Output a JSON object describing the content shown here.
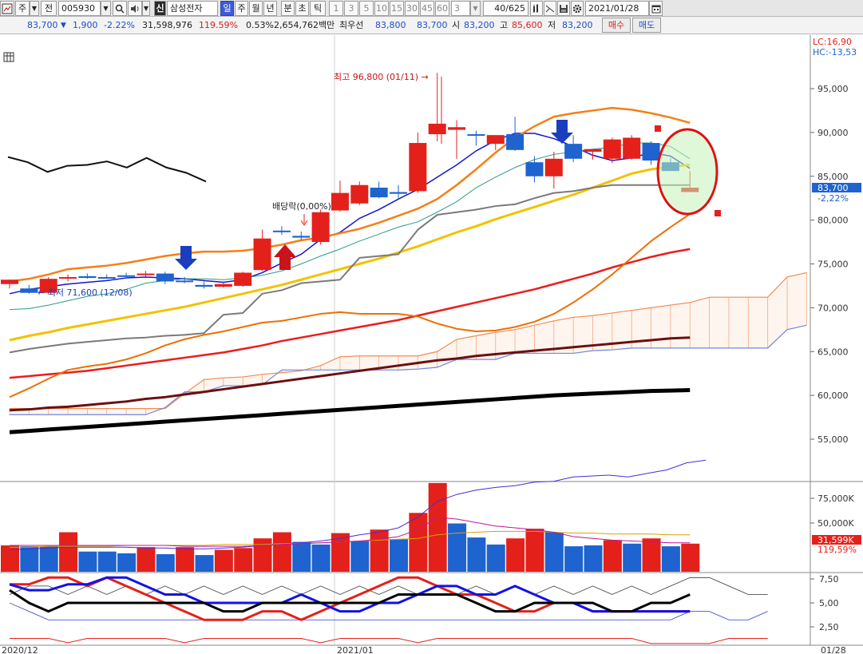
{
  "toolbar": {
    "market": "주",
    "jeon": "전",
    "code": "005930",
    "credit_badge": "신",
    "stock_name": "삼성전자",
    "periods": [
      "일",
      "주",
      "월",
      "년",
      "분",
      "초",
      "틱"
    ],
    "active_period": "일",
    "intervals": [
      "1",
      "3",
      "5",
      "10",
      "15",
      "30",
      "45",
      "60"
    ],
    "interval_value": "3",
    "page_count": "40/625",
    "date": "2021/01/28"
  },
  "quote": {
    "price": "83,700",
    "change": "1,900",
    "change_pct": "-2.22%",
    "volume": "31,598,976",
    "vol_ratio": "119.59%",
    "turnover": "0.53%",
    "amount": "2,654,762백만",
    "bid_label": "최우선",
    "bid_sell": "83,800",
    "bid_buy": "83,700",
    "open_label": "시",
    "open": "83,200",
    "high_label": "고",
    "high": "85,600",
    "low_label": "저",
    "low": "83,200",
    "buy_button": "매수",
    "sell_button": "매도"
  },
  "colors": {
    "up": "#e4201b",
    "down": "#1e63cf",
    "bg": "#ffffff",
    "axis": "#333333"
  },
  "icons": [
    "dropdown-arrow-icon",
    "search-icon",
    "speaker-icon",
    "grid-icon",
    "chart-settings-icon",
    "save-icon",
    "gear-icon",
    "calendar-icon",
    "chart-menu-icon",
    "arrow-down-icon",
    "arrow-up-icon"
  ],
  "chart_data": {
    "type": "candlestick",
    "price_axis": {
      "min": 55000,
      "max": 95000,
      "ticks": [
        "95,000",
        "90,000",
        "85,000",
        "80,000",
        "75,000",
        "70,000",
        "65,000",
        "60,000",
        "55,000"
      ]
    },
    "volume_axis": {
      "ticks": [
        "75,000K",
        "50,000K"
      ]
    },
    "osc_axis": {
      "ticks": [
        "7,50",
        "5,00",
        "2,50"
      ]
    },
    "x_labels": [
      "2020/12",
      "2021/01",
      "01/28"
    ],
    "legend": {
      "lc": "LC:16,90",
      "hc": "HC:-13,53"
    },
    "last_price_label": "83,700",
    "last_change_label": "-2,22%",
    "last_volume_label": "31,599K",
    "last_vol_ratio_label": "119,59%",
    "annotations": {
      "high": "최고 96,800 (01/11) →",
      "low": "← 최저 71,600 (12/08)",
      "dividend": "배당락(0,00%)"
    },
    "candles": [
      {
        "o": 72700,
        "h": 73200,
        "l": 72200,
        "c": 73200
      },
      {
        "o": 72200,
        "h": 72600,
        "l": 71600,
        "c": 71700
      },
      {
        "o": 71700,
        "h": 73500,
        "l": 71600,
        "c": 73300
      },
      {
        "o": 73400,
        "h": 73800,
        "l": 73000,
        "c": 73500
      },
      {
        "o": 73600,
        "h": 73900,
        "l": 73300,
        "c": 73400
      },
      {
        "o": 73500,
        "h": 73800,
        "l": 73300,
        "c": 73400
      },
      {
        "o": 73700,
        "h": 74000,
        "l": 73400,
        "c": 73600
      },
      {
        "o": 73800,
        "h": 74200,
        "l": 73500,
        "c": 73900
      },
      {
        "o": 73900,
        "h": 74100,
        "l": 72700,
        "c": 73000
      },
      {
        "o": 73100,
        "h": 73500,
        "l": 72800,
        "c": 73000
      },
      {
        "o": 72600,
        "h": 73000,
        "l": 72200,
        "c": 72400
      },
      {
        "o": 72400,
        "h": 73000,
        "l": 72300,
        "c": 72700
      },
      {
        "o": 72500,
        "h": 74100,
        "l": 72400,
        "c": 74000
      },
      {
        "o": 74300,
        "h": 78900,
        "l": 74200,
        "c": 77900
      },
      {
        "o": 78800,
        "h": 79300,
        "l": 78300,
        "c": 78700
      },
      {
        "o": 78200,
        "h": 78700,
        "l": 77700,
        "c": 78000
      },
      {
        "o": 77500,
        "h": 81200,
        "l": 77200,
        "c": 80900
      },
      {
        "o": 81100,
        "h": 84500,
        "l": 81000,
        "c": 83100
      },
      {
        "o": 81900,
        "h": 84400,
        "l": 81700,
        "c": 84000
      },
      {
        "o": 83700,
        "h": 84400,
        "l": 82500,
        "c": 82600
      },
      {
        "o": 83200,
        "h": 84000,
        "l": 82400,
        "c": 83000
      },
      {
        "o": 83300,
        "h": 90000,
        "l": 83100,
        "c": 88800
      },
      {
        "o": 89800,
        "h": 96800,
        "l": 89000,
        "c": 91000
      },
      {
        "o": 90300,
        "h": 91400,
        "l": 87000,
        "c": 90600
      },
      {
        "o": 89800,
        "h": 90200,
        "l": 88500,
        "c": 89700
      },
      {
        "o": 88700,
        "h": 89700,
        "l": 88000,
        "c": 89700
      },
      {
        "o": 89800,
        "h": 91800,
        "l": 87900,
        "c": 88000
      },
      {
        "o": 86600,
        "h": 87300,
        "l": 84300,
        "c": 85000
      },
      {
        "o": 85000,
        "h": 87800,
        "l": 83600,
        "c": 87000
      },
      {
        "o": 88700,
        "h": 89700,
        "l": 86600,
        "c": 87000
      },
      {
        "o": 87800,
        "h": 88000,
        "l": 86900,
        "c": 88100
      },
      {
        "o": 87000,
        "h": 89400,
        "l": 86500,
        "c": 89200
      },
      {
        "o": 87000,
        "h": 89700,
        "l": 86900,
        "c": 89400
      },
      {
        "o": 88800,
        "h": 89000,
        "l": 86300,
        "c": 86800
      },
      {
        "o": 86600,
        "h": 87100,
        "l": 85800,
        "c": 85600
      },
      {
        "o": 83200,
        "h": 85600,
        "l": 83200,
        "c": 83700
      }
    ],
    "volume": [
      {
        "v": 30,
        "up": true
      },
      {
        "v": 29,
        "up": false
      },
      {
        "v": 29,
        "up": false
      },
      {
        "v": 45,
        "up": true
      },
      {
        "v": 23,
        "up": false
      },
      {
        "v": 23,
        "up": false
      },
      {
        "v": 21,
        "up": false
      },
      {
        "v": 28,
        "up": true
      },
      {
        "v": 20,
        "up": false
      },
      {
        "v": 28,
        "up": true
      },
      {
        "v": 19,
        "up": false
      },
      {
        "v": 25,
        "up": true
      },
      {
        "v": 27,
        "up": true
      },
      {
        "v": 38,
        "up": true
      },
      {
        "v": 45,
        "up": true
      },
      {
        "v": 34,
        "up": false
      },
      {
        "v": 31,
        "up": false
      },
      {
        "v": 44,
        "up": true
      },
      {
        "v": 35,
        "up": false
      },
      {
        "v": 48,
        "up": true
      },
      {
        "v": 37,
        "up": false
      },
      {
        "v": 67,
        "up": true
      },
      {
        "v": 101,
        "up": true
      },
      {
        "v": 55,
        "up": false
      },
      {
        "v": 39,
        "up": false
      },
      {
        "v": 31,
        "up": false
      },
      {
        "v": 38,
        "up": true
      },
      {
        "v": 49,
        "up": true
      },
      {
        "v": 45,
        "up": false
      },
      {
        "v": 29,
        "up": false
      },
      {
        "v": 30,
        "up": false
      },
      {
        "v": 36,
        "up": true
      },
      {
        "v": 32,
        "up": false
      },
      {
        "v": 38,
        "up": true
      },
      {
        "v": 29,
        "up": false
      },
      {
        "v": 32,
        "up": true
      }
    ],
    "series": [
      {
        "name": "MA5",
        "color": "#1515c8",
        "values": [
          71600,
          72100,
          72400,
          72700,
          72900,
          73100,
          73400,
          73500,
          73400,
          73300,
          73100,
          72900,
          73200,
          74000,
          75100,
          76100,
          77800,
          78600,
          80200,
          81200,
          82400,
          83500,
          84900,
          86300,
          87900,
          89100,
          89900,
          89900,
          89300,
          88400,
          87400,
          86800,
          87100,
          87700,
          87300,
          85900
        ]
      },
      {
        "name": "MA10",
        "color": "#2a9a8a",
        "values": [
          69800,
          69900,
          70300,
          70800,
          71300,
          71600,
          72100,
          72800,
          73100,
          73300,
          73300,
          73200,
          73400,
          73700,
          74200,
          75000,
          75900,
          76700,
          77600,
          78400,
          79200,
          79800,
          80900,
          82100,
          83700,
          84900,
          86000,
          86900,
          87500,
          87800,
          88100,
          88300,
          88800,
          88800,
          88400,
          87000
        ]
      },
      {
        "name": "MA20",
        "color": "#f57f17",
        "values": [
          73000,
          73300,
          73800,
          74400,
          74600,
          74800,
          75100,
          75500,
          75900,
          76200,
          76400,
          76400,
          76500,
          76800,
          77200,
          77700,
          78000,
          78500,
          79000,
          79700,
          80500,
          81300,
          82400,
          84000,
          85800,
          87700,
          89400,
          90700,
          91800,
          92200,
          92500,
          92800,
          92600,
          92200,
          91700,
          91100
        ]
      },
      {
        "name": "MA60",
        "color": "#f2c200",
        "values": [
          66300,
          66800,
          67200,
          67700,
          68100,
          68500,
          68900,
          69300,
          69700,
          70100,
          70600,
          71100,
          71600,
          72100,
          72600,
          73200,
          73800,
          74400,
          75000,
          75600,
          76300,
          77000,
          77800,
          78600,
          79300,
          80100,
          80800,
          81500,
          82200,
          82900,
          83700,
          84500,
          85300,
          85800,
          86100,
          86300
        ]
      },
      {
        "name": "MA120",
        "color": "#7a7a7a",
        "values": [
          64900,
          65300,
          65600,
          65900,
          66100,
          66300,
          66500,
          66600,
          66800,
          66900,
          67100,
          69200,
          69400,
          71600,
          72000,
          72800,
          73000,
          73200,
          75700,
          75900,
          76100,
          78900,
          80600,
          80900,
          81200,
          81600,
          81800,
          82500,
          83100,
          83300,
          83700,
          84000,
          84000,
          84000,
          84000,
          84000
        ]
      },
      {
        "name": "MA240",
        "color": "#ed1c1c",
        "values": [
          62000,
          62200,
          62400,
          62600,
          62800,
          63100,
          63400,
          63700,
          64000,
          64300,
          64600,
          64900,
          65300,
          65700,
          66200,
          66600,
          67000,
          67400,
          67800,
          68200,
          68600,
          69100,
          69600,
          70100,
          70600,
          71100,
          71600,
          72100,
          72700,
          73300,
          73900,
          74600,
          75200,
          75800,
          76300,
          76700
        ]
      },
      {
        "name": "Envelope",
        "color": "#ee6f00",
        "values": [
          59800,
          60800,
          61900,
          62900,
          63300,
          63600,
          64100,
          64800,
          65700,
          66400,
          66900,
          67300,
          67800,
          68300,
          68500,
          68900,
          69300,
          69500,
          69300,
          69300,
          69300,
          69000,
          68200,
          67600,
          67300,
          67400,
          67800,
          68400,
          69300,
          70600,
          72100,
          73800,
          75700,
          77600,
          79200,
          80700
        ]
      },
      {
        "name": "MA-long",
        "color": "#6b1010",
        "values": [
          58300,
          58400,
          58600,
          58700,
          58900,
          59100,
          59300,
          59600,
          59800,
          60100,
          60400,
          60700,
          61000,
          61300,
          61600,
          61900,
          62200,
          62500,
          62800,
          63100,
          63400,
          63700,
          64000,
          64200,
          64500,
          64700,
          64900,
          65100,
          65300,
          65500,
          65700,
          65900,
          66100,
          66300,
          66500,
          66600
        ]
      },
      {
        "name": "MA-very-long",
        "color": "#000000",
        "values": [
          55800,
          55950,
          56100,
          56250,
          56400,
          56550,
          56700,
          56850,
          57000,
          57150,
          57300,
          57450,
          57600,
          57750,
          57900,
          58050,
          58200,
          58350,
          58500,
          58650,
          58800,
          58950,
          59100,
          59250,
          59400,
          59550,
          59700,
          59850,
          60000,
          60100,
          60200,
          60300,
          60400,
          60500,
          60550,
          60600
        ]
      }
    ],
    "cloud_upper": [
      58500,
      58500,
      58500,
      58500,
      58500,
      58500,
      58500,
      58500,
      58500,
      60200,
      61800,
      62000,
      62100,
      62400,
      62600,
      62800,
      63400,
      64400,
      64500,
      64500,
      64500,
      64500,
      65000,
      66400,
      66800,
      67200,
      67500,
      68000,
      68500,
      68900,
      69100,
      69400,
      69700,
      70000,
      70300,
      70600,
      71200,
      71200,
      71200,
      71200,
      73500,
      74000
    ],
    "cloud_lower": [
      57800,
      57800,
      57800,
      57800,
      57800,
      57800,
      57800,
      57800,
      58600,
      60400,
      60400,
      61100,
      61100,
      61200,
      62900,
      62900,
      62900,
      62900,
      62900,
      62900,
      62900,
      63000,
      63200,
      64100,
      64100,
      64100,
      64800,
      64800,
      64800,
      64800,
      65100,
      65200,
      65400,
      65400,
      65400,
      65400,
      65400,
      65400,
      65400,
      65400,
      67500,
      68000
    ],
    "left_black_line": [
      87200,
      86600,
      85500,
      86200,
      86300,
      86700,
      86000,
      87100,
      86000,
      85400,
      84400
    ]
  }
}
